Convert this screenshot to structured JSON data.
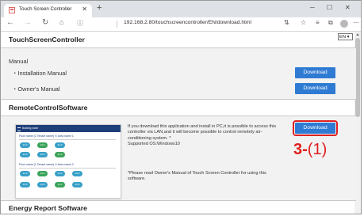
{
  "browser": {
    "tab_title": "Touch Screen Controller",
    "url": "192.168.2.80/touchscreencontroller/EN/download.html"
  },
  "page": {
    "header_title": "TouchScreenController",
    "language_value": "EN",
    "manual": {
      "heading": "Manual",
      "items": [
        {
          "label": "・Installation Manual",
          "button": "Download"
        },
        {
          "label": "・Owner's Manual",
          "button": "Download"
        }
      ]
    },
    "remote": {
      "heading": "RemoteControlSoftware",
      "description": [
        "If you download this application and install in PC,it is possible to access this",
        "controller via LAN,and it will become possible to control remotely air-",
        "conditioning system. *",
        "Supported OS:Windows10"
      ],
      "note": [
        "*Please read Owner's Manual of Touch Screen Controller for using this",
        "software."
      ],
      "button": "Download",
      "step_label": "3-",
      "step_sub": "(1)",
      "screenshot": {
        "bar_title": "Building name",
        "rows": [
          "Floor name (1 Tenant name)  ✕  Area name 1",
          "Floor name (1 Tenant name)  ✕  Area name 2"
        ],
        "pill_value": "24.0"
      }
    },
    "energy": {
      "heading": "Energy Report Software"
    }
  }
}
